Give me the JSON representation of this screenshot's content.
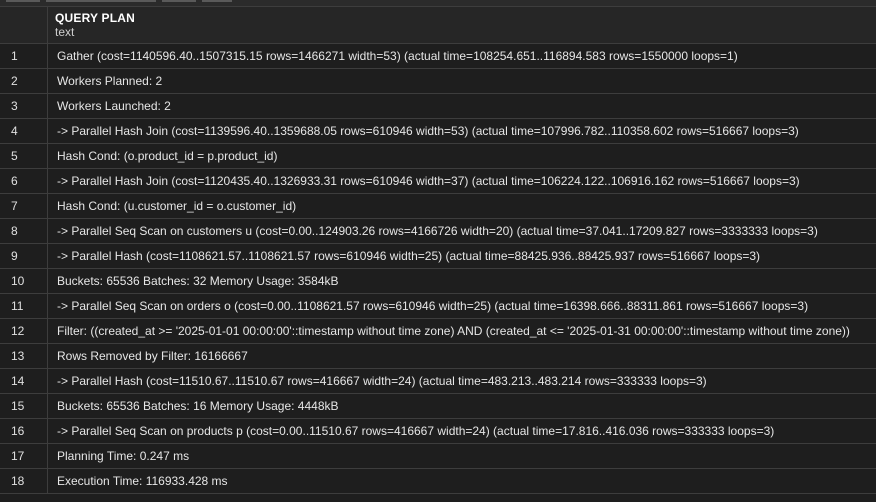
{
  "result_grid": {
    "column": {
      "name": "QUERY PLAN",
      "type": "text"
    },
    "rows": [
      {
        "num": "1",
        "text": "Gather (cost=1140596.40..1507315.15 rows=1466271 width=53) (actual time=108254.651..116894.583 rows=1550000 loops=1)"
      },
      {
        "num": "2",
        "text": "Workers Planned: 2"
      },
      {
        "num": "3",
        "text": "Workers Launched: 2"
      },
      {
        "num": "4",
        "text": "-> Parallel Hash Join (cost=1139596.40..1359688.05 rows=610946 width=53) (actual time=107996.782..110358.602 rows=516667 loops=3)"
      },
      {
        "num": "5",
        "text": "Hash Cond: (o.product_id = p.product_id)"
      },
      {
        "num": "6",
        "text": "-> Parallel Hash Join (cost=1120435.40..1326933.31 rows=610946 width=37) (actual time=106224.122..106916.162 rows=516667 loops=3)"
      },
      {
        "num": "7",
        "text": "Hash Cond: (u.customer_id = o.customer_id)"
      },
      {
        "num": "8",
        "text": "-> Parallel Seq Scan on customers u (cost=0.00..124903.26 rows=4166726 width=20) (actual time=37.041..17209.827 rows=3333333 loops=3)"
      },
      {
        "num": "9",
        "text": "-> Parallel Hash (cost=1108621.57..1108621.57 rows=610946 width=25) (actual time=88425.936..88425.937 rows=516667 loops=3)"
      },
      {
        "num": "10",
        "text": "Buckets: 65536 Batches: 32 Memory Usage: 3584kB"
      },
      {
        "num": "11",
        "text": "-> Parallel Seq Scan on orders o (cost=0.00..1108621.57 rows=610946 width=25) (actual time=16398.666..88311.861 rows=516667 loops=3)"
      },
      {
        "num": "12",
        "text": "Filter: ((created_at >= '2025-01-01 00:00:00'::timestamp without time zone) AND (created_at <= '2025-01-31 00:00:00'::timestamp without time zone))"
      },
      {
        "num": "13",
        "text": "Rows Removed by Filter: 16166667"
      },
      {
        "num": "14",
        "text": "-> Parallel Hash (cost=11510.67..11510.67 rows=416667 width=24) (actual time=483.213..483.214 rows=333333 loops=3)"
      },
      {
        "num": "15",
        "text": "Buckets: 65536 Batches: 16 Memory Usage: 4448kB"
      },
      {
        "num": "16",
        "text": "-> Parallel Seq Scan on products p (cost=0.00..11510.67 rows=416667 width=24) (actual time=17.816..416.036 rows=333333 loops=3)"
      },
      {
        "num": "17",
        "text": "Planning Time: 0.247 ms"
      },
      {
        "num": "18",
        "text": "Execution Time: 116933.428 ms"
      }
    ]
  }
}
